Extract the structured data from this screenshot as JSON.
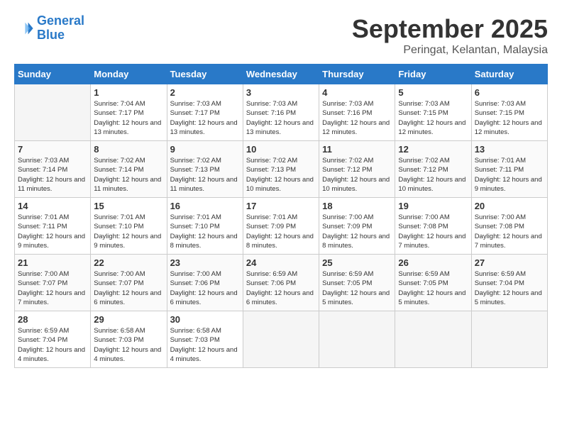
{
  "logo": {
    "line1": "General",
    "line2": "Blue"
  },
  "title": "September 2025",
  "location": "Peringat, Kelantan, Malaysia",
  "columns": [
    "Sunday",
    "Monday",
    "Tuesday",
    "Wednesday",
    "Thursday",
    "Friday",
    "Saturday"
  ],
  "weeks": [
    [
      {
        "day": "",
        "sunrise": "",
        "sunset": "",
        "daylight": "",
        "empty": true
      },
      {
        "day": "1",
        "sunrise": "Sunrise: 7:04 AM",
        "sunset": "Sunset: 7:17 PM",
        "daylight": "Daylight: 12 hours and 13 minutes."
      },
      {
        "day": "2",
        "sunrise": "Sunrise: 7:03 AM",
        "sunset": "Sunset: 7:17 PM",
        "daylight": "Daylight: 12 hours and 13 minutes."
      },
      {
        "day": "3",
        "sunrise": "Sunrise: 7:03 AM",
        "sunset": "Sunset: 7:16 PM",
        "daylight": "Daylight: 12 hours and 13 minutes."
      },
      {
        "day": "4",
        "sunrise": "Sunrise: 7:03 AM",
        "sunset": "Sunset: 7:16 PM",
        "daylight": "Daylight: 12 hours and 12 minutes."
      },
      {
        "day": "5",
        "sunrise": "Sunrise: 7:03 AM",
        "sunset": "Sunset: 7:15 PM",
        "daylight": "Daylight: 12 hours and 12 minutes."
      },
      {
        "day": "6",
        "sunrise": "Sunrise: 7:03 AM",
        "sunset": "Sunset: 7:15 PM",
        "daylight": "Daylight: 12 hours and 12 minutes."
      }
    ],
    [
      {
        "day": "7",
        "sunrise": "Sunrise: 7:03 AM",
        "sunset": "Sunset: 7:14 PM",
        "daylight": "Daylight: 12 hours and 11 minutes."
      },
      {
        "day": "8",
        "sunrise": "Sunrise: 7:02 AM",
        "sunset": "Sunset: 7:14 PM",
        "daylight": "Daylight: 12 hours and 11 minutes."
      },
      {
        "day": "9",
        "sunrise": "Sunrise: 7:02 AM",
        "sunset": "Sunset: 7:13 PM",
        "daylight": "Daylight: 12 hours and 11 minutes."
      },
      {
        "day": "10",
        "sunrise": "Sunrise: 7:02 AM",
        "sunset": "Sunset: 7:13 PM",
        "daylight": "Daylight: 12 hours and 10 minutes."
      },
      {
        "day": "11",
        "sunrise": "Sunrise: 7:02 AM",
        "sunset": "Sunset: 7:12 PM",
        "daylight": "Daylight: 12 hours and 10 minutes."
      },
      {
        "day": "12",
        "sunrise": "Sunrise: 7:02 AM",
        "sunset": "Sunset: 7:12 PM",
        "daylight": "Daylight: 12 hours and 10 minutes."
      },
      {
        "day": "13",
        "sunrise": "Sunrise: 7:01 AM",
        "sunset": "Sunset: 7:11 PM",
        "daylight": "Daylight: 12 hours and 9 minutes."
      }
    ],
    [
      {
        "day": "14",
        "sunrise": "Sunrise: 7:01 AM",
        "sunset": "Sunset: 7:11 PM",
        "daylight": "Daylight: 12 hours and 9 minutes."
      },
      {
        "day": "15",
        "sunrise": "Sunrise: 7:01 AM",
        "sunset": "Sunset: 7:10 PM",
        "daylight": "Daylight: 12 hours and 9 minutes."
      },
      {
        "day": "16",
        "sunrise": "Sunrise: 7:01 AM",
        "sunset": "Sunset: 7:10 PM",
        "daylight": "Daylight: 12 hours and 8 minutes."
      },
      {
        "day": "17",
        "sunrise": "Sunrise: 7:01 AM",
        "sunset": "Sunset: 7:09 PM",
        "daylight": "Daylight: 12 hours and 8 minutes."
      },
      {
        "day": "18",
        "sunrise": "Sunrise: 7:00 AM",
        "sunset": "Sunset: 7:09 PM",
        "daylight": "Daylight: 12 hours and 8 minutes."
      },
      {
        "day": "19",
        "sunrise": "Sunrise: 7:00 AM",
        "sunset": "Sunset: 7:08 PM",
        "daylight": "Daylight: 12 hours and 7 minutes."
      },
      {
        "day": "20",
        "sunrise": "Sunrise: 7:00 AM",
        "sunset": "Sunset: 7:08 PM",
        "daylight": "Daylight: 12 hours and 7 minutes."
      }
    ],
    [
      {
        "day": "21",
        "sunrise": "Sunrise: 7:00 AM",
        "sunset": "Sunset: 7:07 PM",
        "daylight": "Daylight: 12 hours and 7 minutes."
      },
      {
        "day": "22",
        "sunrise": "Sunrise: 7:00 AM",
        "sunset": "Sunset: 7:07 PM",
        "daylight": "Daylight: 12 hours and 6 minutes."
      },
      {
        "day": "23",
        "sunrise": "Sunrise: 7:00 AM",
        "sunset": "Sunset: 7:06 PM",
        "daylight": "Daylight: 12 hours and 6 minutes."
      },
      {
        "day": "24",
        "sunrise": "Sunrise: 6:59 AM",
        "sunset": "Sunset: 7:06 PM",
        "daylight": "Daylight: 12 hours and 6 minutes."
      },
      {
        "day": "25",
        "sunrise": "Sunrise: 6:59 AM",
        "sunset": "Sunset: 7:05 PM",
        "daylight": "Daylight: 12 hours and 5 minutes."
      },
      {
        "day": "26",
        "sunrise": "Sunrise: 6:59 AM",
        "sunset": "Sunset: 7:05 PM",
        "daylight": "Daylight: 12 hours and 5 minutes."
      },
      {
        "day": "27",
        "sunrise": "Sunrise: 6:59 AM",
        "sunset": "Sunset: 7:04 PM",
        "daylight": "Daylight: 12 hours and 5 minutes."
      }
    ],
    [
      {
        "day": "28",
        "sunrise": "Sunrise: 6:59 AM",
        "sunset": "Sunset: 7:04 PM",
        "daylight": "Daylight: 12 hours and 4 minutes."
      },
      {
        "day": "29",
        "sunrise": "Sunrise: 6:58 AM",
        "sunset": "Sunset: 7:03 PM",
        "daylight": "Daylight: 12 hours and 4 minutes."
      },
      {
        "day": "30",
        "sunrise": "Sunrise: 6:58 AM",
        "sunset": "Sunset: 7:03 PM",
        "daylight": "Daylight: 12 hours and 4 minutes."
      },
      {
        "day": "",
        "sunrise": "",
        "sunset": "",
        "daylight": "",
        "empty": true
      },
      {
        "day": "",
        "sunrise": "",
        "sunset": "",
        "daylight": "",
        "empty": true
      },
      {
        "day": "",
        "sunrise": "",
        "sunset": "",
        "daylight": "",
        "empty": true
      },
      {
        "day": "",
        "sunrise": "",
        "sunset": "",
        "daylight": "",
        "empty": true
      }
    ]
  ]
}
